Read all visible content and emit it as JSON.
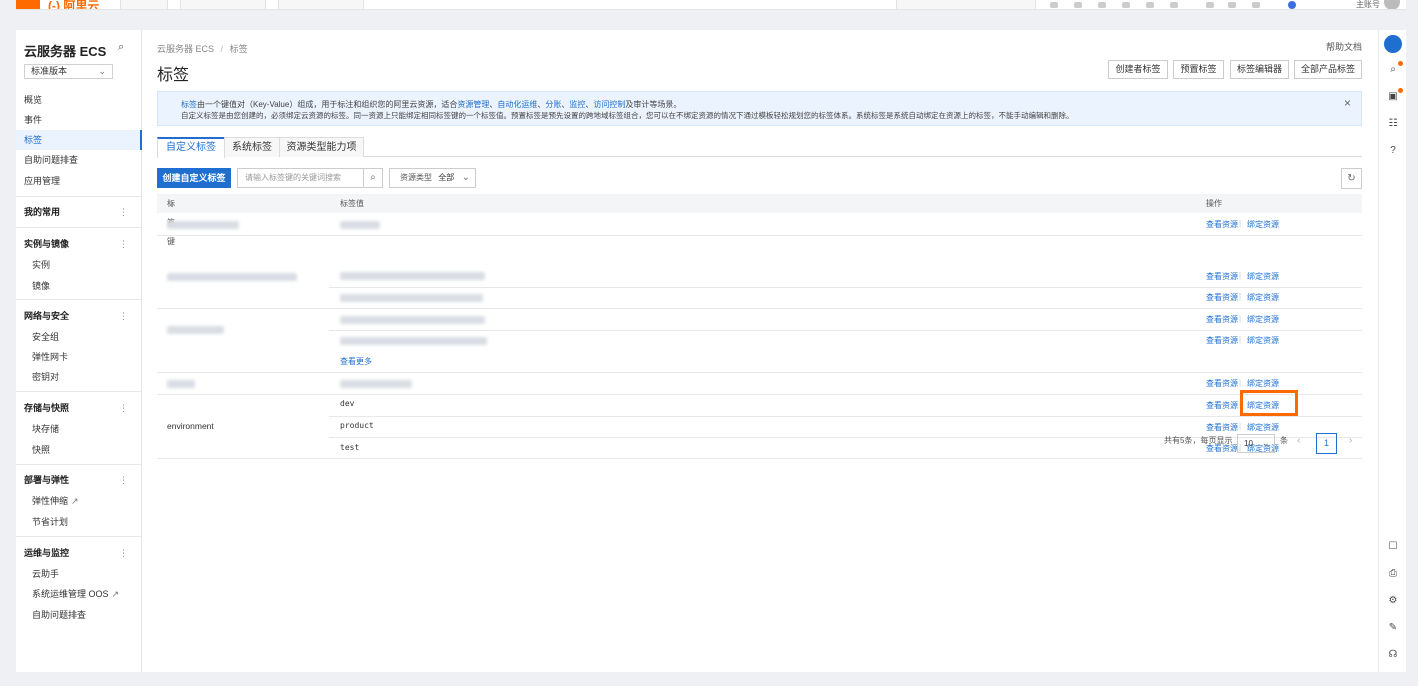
{
  "topbar": {
    "account": "主账号"
  },
  "sidebar": {
    "title": "云服务器 ECS",
    "version_select": "标准版本",
    "items_top": [
      "概览",
      "事件",
      "标签",
      "自助问题排查",
      "应用管理"
    ],
    "groups": {
      "favorites": "我的常用",
      "instances": {
        "label": "实例与镜像",
        "items": [
          "实例",
          "镜像"
        ]
      },
      "network": {
        "label": "网络与安全",
        "items": [
          "安全组",
          "弹性网卡",
          "密钥对"
        ]
      },
      "storage": {
        "label": "存储与快照",
        "items": [
          "块存储",
          "快照"
        ]
      },
      "deploy": {
        "label": "部署与弹性",
        "items": [
          "弹性伸缩",
          "节省计划"
        ]
      },
      "ops": {
        "label": "运维与监控",
        "items": [
          "云助手",
          "系统运维管理 OOS",
          "自助问题排查"
        ]
      }
    }
  },
  "main": {
    "breadcrumb": {
      "root": "云服务器 ECS",
      "sep": "/",
      "current": "标签"
    },
    "title": "标签",
    "help_docs": "帮助文档",
    "header_buttons": [
      "创建者标签",
      "预置标签",
      "标签编辑器",
      "全部产品标签"
    ],
    "info": {
      "line1_prefix": "标签",
      "line1_mid": "由一个键值对（Key-Value）组成，用于标注和组织您的阿里云资源，适合",
      "link1": "资源管理",
      "link2": "自动化运维",
      "link3": "分账",
      "link4": "监控",
      "link5": "访问控制",
      "line1_suffix": "及审计等场景。",
      "line2": "自定义标签是由您创建的，必须绑定云资源的标签。同一资源上只能绑定相同标签键的一个标签值。预置标签是预先设置的跨地域标签组合，您可以在不绑定资源的情况下通过模板轻松规划您的标签体系。系统标签是系统自动绑定在资源上的标签，不能手动编辑和删除。",
      "close": "×"
    },
    "tabs": [
      "自定义标签",
      "系统标签",
      "资源类型能力项"
    ],
    "create_button": "创建自定义标签",
    "search_placeholder": "请输入标签键的关键词搜索",
    "type_select": {
      "label": "资源类型",
      "value": "全部"
    },
    "table": {
      "headers": {
        "key": "标签键",
        "sort": "⇅",
        "value": "标签值",
        "ops": "操作"
      },
      "ops": {
        "view": "查看资源",
        "bind": "绑定资源",
        "sep": "|"
      },
      "see_more": "查看更多",
      "env_key": "environment",
      "env_values": [
        "dev",
        "product",
        "test"
      ]
    },
    "pager": {
      "total": "共有5条，每页显示",
      "size": "10",
      "unit": "条",
      "page": "1"
    }
  }
}
